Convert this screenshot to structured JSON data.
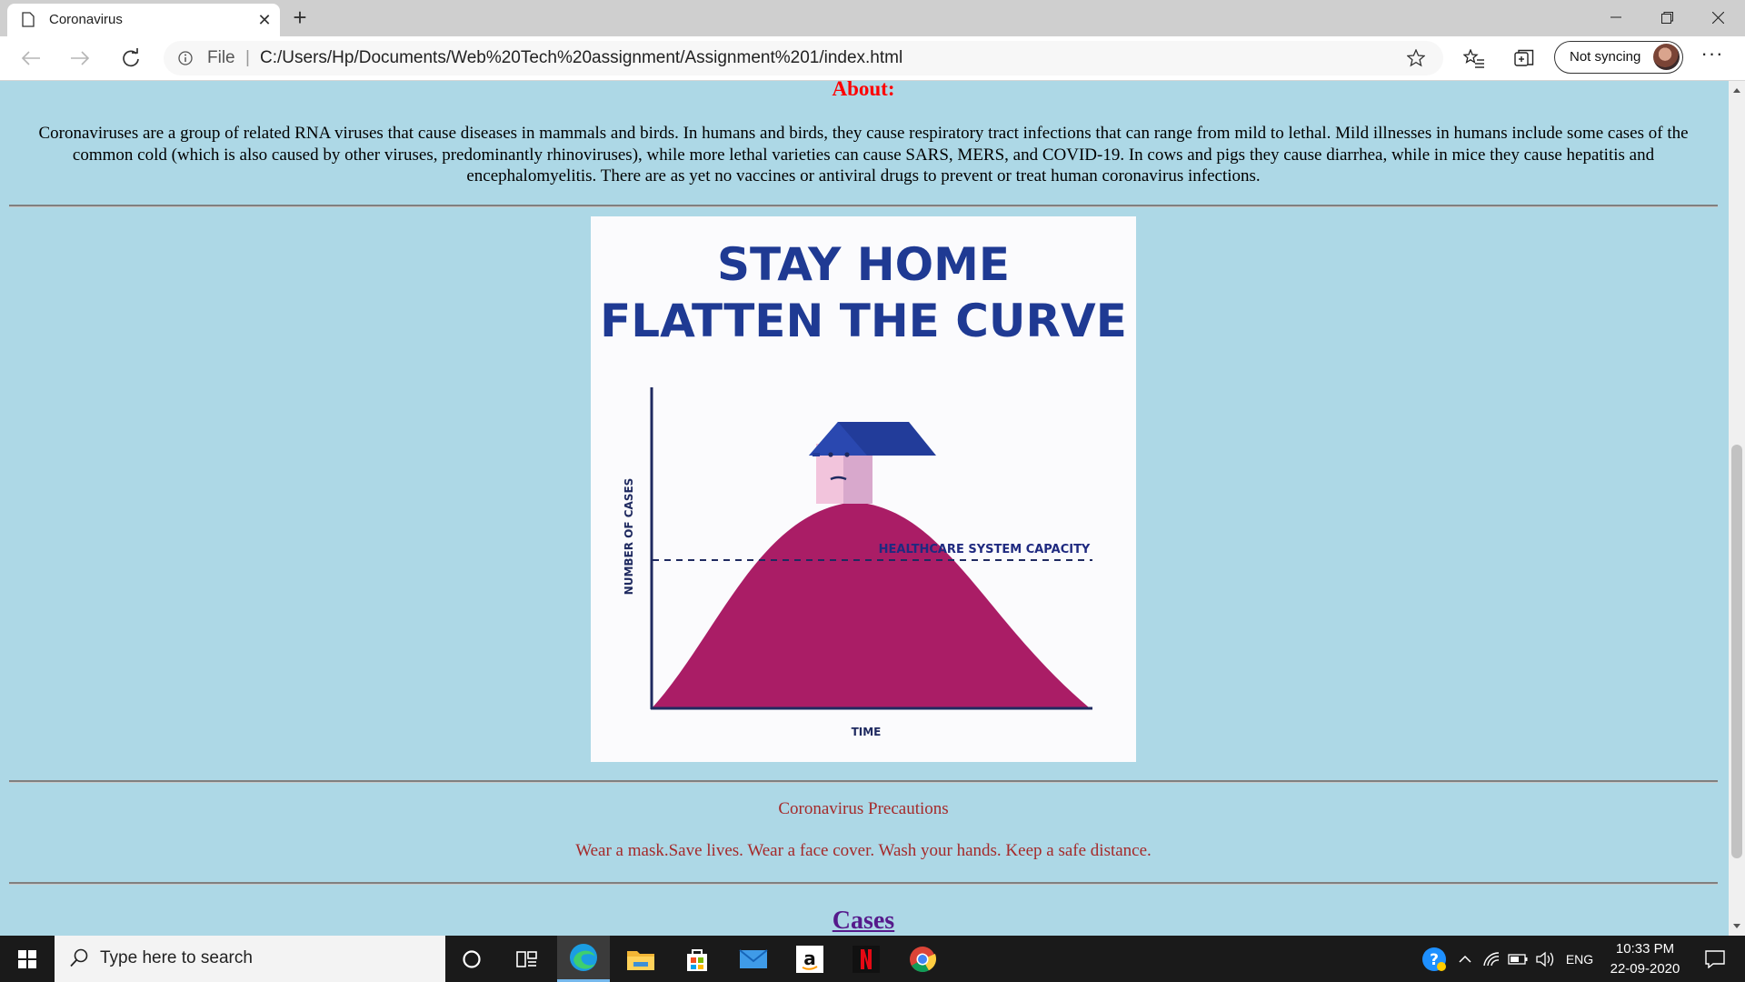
{
  "browser": {
    "tab_title": "Coronavirus",
    "new_tab_symbol": "+",
    "address_prefix": "File",
    "address_separator": "|",
    "url": "C:/Users/Hp/Documents/Web%20Tech%20assignment/Assignment%201/index.html",
    "sync_label": "Not syncing",
    "more_label": "···"
  },
  "page": {
    "about_heading": "About:",
    "about_text": "Coronaviruses are a group of related RNA viruses that cause diseases in mammals and birds. In humans and birds, they cause respiratory tract infections that can range from mild to lethal. Mild illnesses in humans include some cases of the common cold (which is also caused by other viruses, predominantly rhinoviruses), while more lethal varieties can cause SARS, MERS, and COVID-19. In cows and pigs they cause diarrhea, while in mice they cause hepatitis and encephalomyelitis. There are as yet no vaccines or antiviral drugs to prevent or treat human coronavirus infections.",
    "poster": {
      "title_line1": "STAY HOME",
      "title_line2": "FLATTEN THE CURVE",
      "y_axis_label": "NUMBER OF CASES",
      "x_axis_label": "TIME",
      "capacity_label": "HEALTHCARE SYSTEM CAPACITY"
    },
    "precautions_title": "Coronavirus Precautions",
    "precautions_text": "Wear a mask.Save lives. Wear a face cover. Wash your hands. Keep a safe distance.",
    "cases_heading": "Cases"
  },
  "taskbar": {
    "search_placeholder": "Type here to search",
    "language": "ENG",
    "time": "10:33 PM",
    "date": "22-09-2020",
    "apps": [
      "cortana-icon",
      "task-view-icon",
      "edge-icon",
      "file-explorer-icon",
      "store-icon",
      "mail-icon",
      "amazon-icon",
      "netflix-icon",
      "chrome-icon"
    ]
  },
  "colors": {
    "page_background": "#add8e6",
    "about_heading": "#ff0000",
    "precautions_text": "#a52a2a",
    "cases_link": "#551a8b",
    "poster_navy": "#1f3a93",
    "poster_curve": "#aa1d66"
  }
}
